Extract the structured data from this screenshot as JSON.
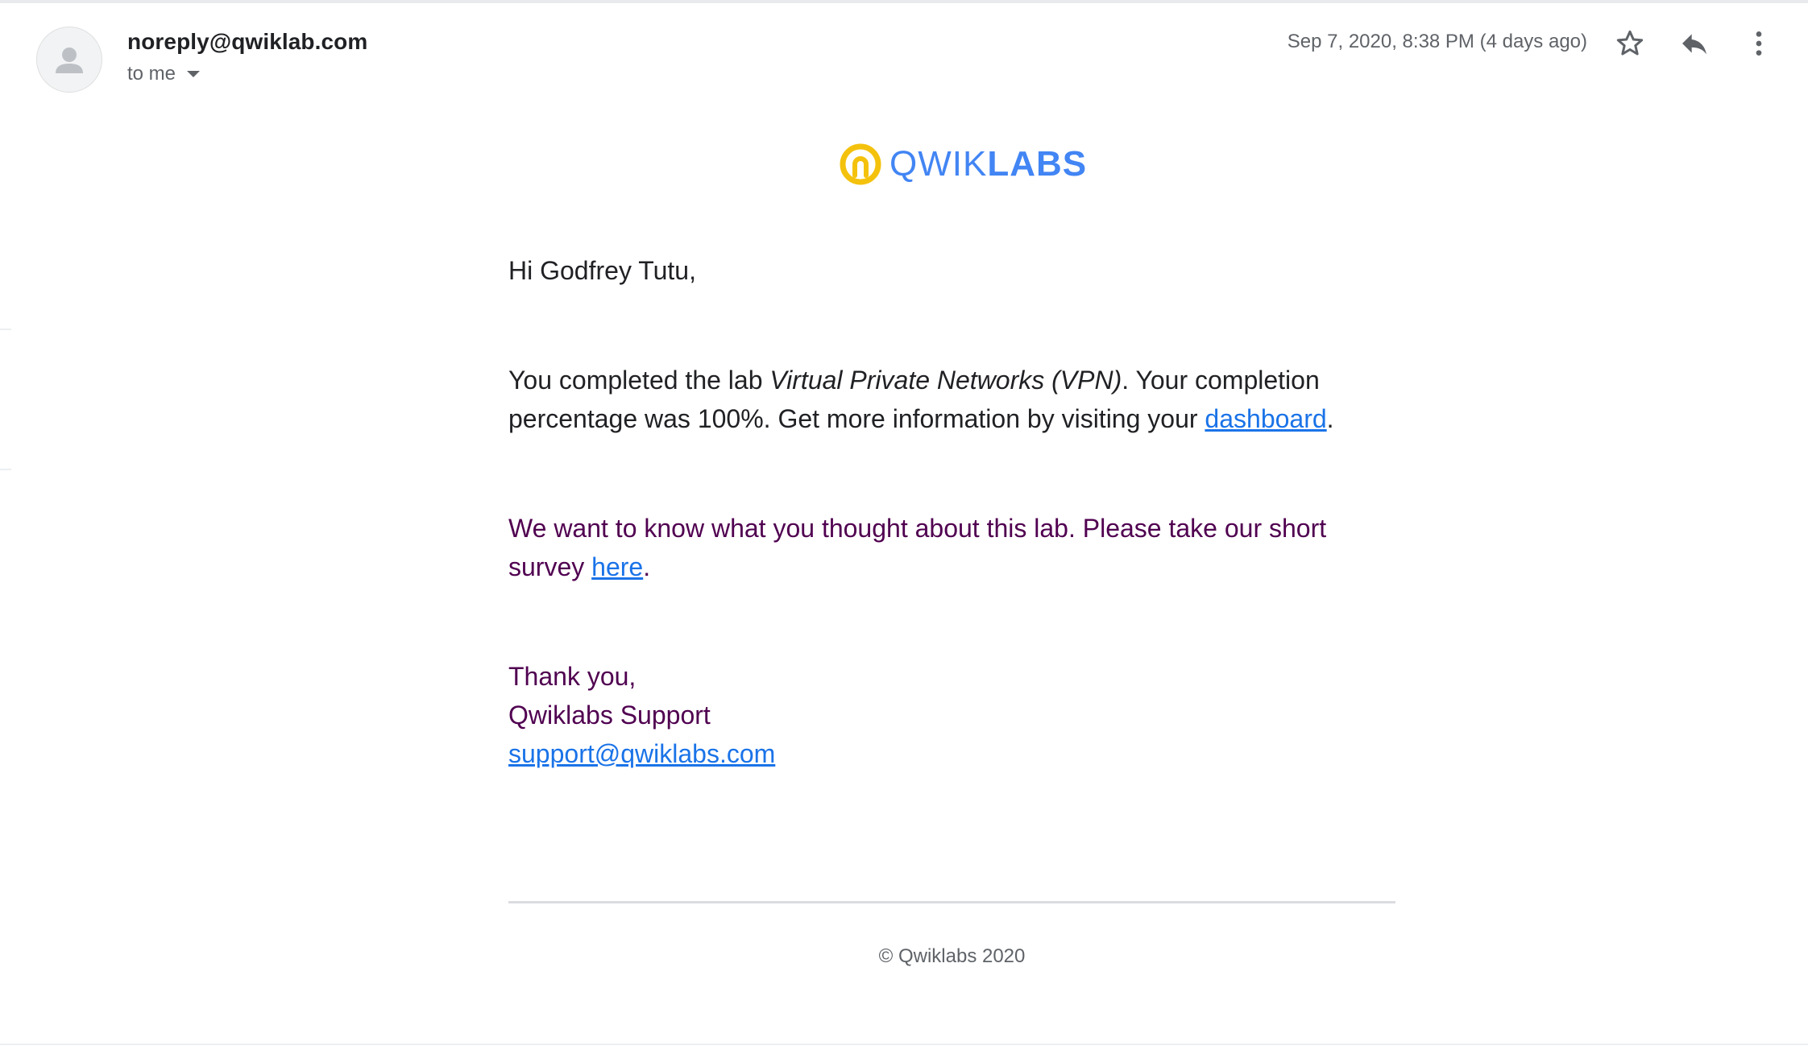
{
  "header": {
    "sender": "noreply@qwiklab.com",
    "recipient_label": "to me",
    "timestamp": "Sep 7, 2020, 8:38 PM (4 days ago)",
    "icons": {
      "avatar": "person-icon",
      "star": "star-outline-icon",
      "reply": "reply-icon",
      "more": "more-vert-icon"
    }
  },
  "email": {
    "logo": {
      "text_thin": "QWIK",
      "text_bold": "LABS",
      "mark_color": "#f4c20d",
      "text_color": "#4285f4"
    },
    "greeting": "Hi Godfrey Tutu,",
    "completion": {
      "prefix": "You completed the lab ",
      "lab_name": "Virtual Private Networks (VPN)",
      "middle": ". Your completion percentage was 100%. Get more information by visiting your ",
      "link_text": "dashboard",
      "suffix": "."
    },
    "survey": {
      "prefix": "We want to know what you thought about this lab. Please take our short survey ",
      "link_text": "here",
      "suffix": "."
    },
    "signoff": {
      "line1": "Thank you,",
      "line2": "Qwiklabs Support",
      "email_link": "support@qwiklabs.com"
    },
    "footer": {
      "copyright": "© Qwiklabs 2020"
    }
  },
  "colors": {
    "link": "#1a73e8",
    "signoff_text": "#500050",
    "secondary_text": "#5f6368"
  }
}
